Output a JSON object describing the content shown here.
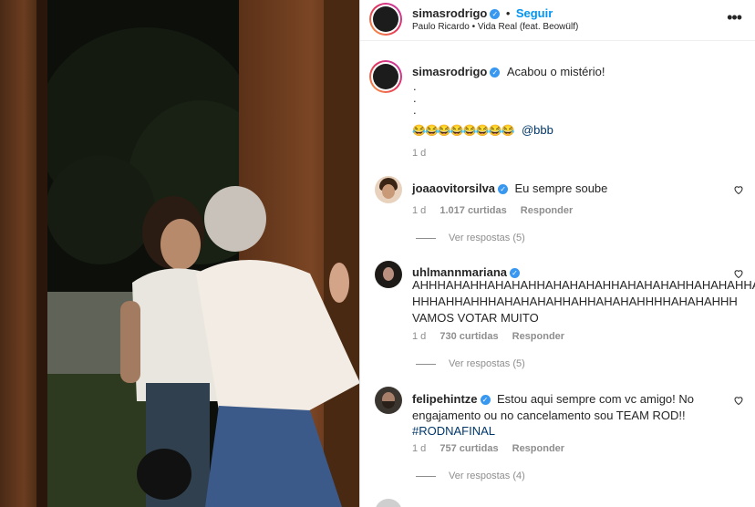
{
  "post": {
    "username": "simasrodrigo",
    "follow_label": "Seguir",
    "audio": "Paulo Ricardo • Vida Real (feat. Beowülf)",
    "more_icon": "more-horizontal-icon",
    "caption": {
      "text": "Acabou o mistério!",
      "dot1": ".",
      "dot2": ".",
      "dot3": ".",
      "emojis": "😂😂😂😂😂😂😂😂",
      "mention": "@bbb",
      "age": "1 d"
    }
  },
  "comments": [
    {
      "username": "joaaovitorsilva",
      "text": "Eu sempre soube",
      "age": "1 d",
      "likes": "1.017 curtidas",
      "reply": "Responder",
      "view_replies": "Ver respostas (5)"
    },
    {
      "username": "uhlmannmariana",
      "line1": "AHHHAHAHHAHAHAHHAHAHAHAHHAHAHAHAHHAHAHAHHA",
      "line2": "HHHAHHAHHHAHAHAHAHHAHHAHAHAHHHHAHAHAHHH",
      "line3": "VAMOS VOTAR MUITO",
      "age": "1 d",
      "likes": "730 curtidas",
      "reply": "Responder",
      "view_replies": "Ver respostas (5)"
    },
    {
      "username": "felipehintze",
      "line1": "Estou aqui sempre com vc amigo! No",
      "line2": "engajamento ou no cancelamento sou TEAM ROD!!",
      "hashtag": "#RODNAFINAL",
      "age": "1 d",
      "likes": "757 curtidas",
      "reply": "Responder",
      "view_replies": "Ver respostas (4)"
    }
  ],
  "colors": {
    "verified": "#3897f0",
    "link": "#0095f6",
    "muted": "#8e8e8e"
  }
}
